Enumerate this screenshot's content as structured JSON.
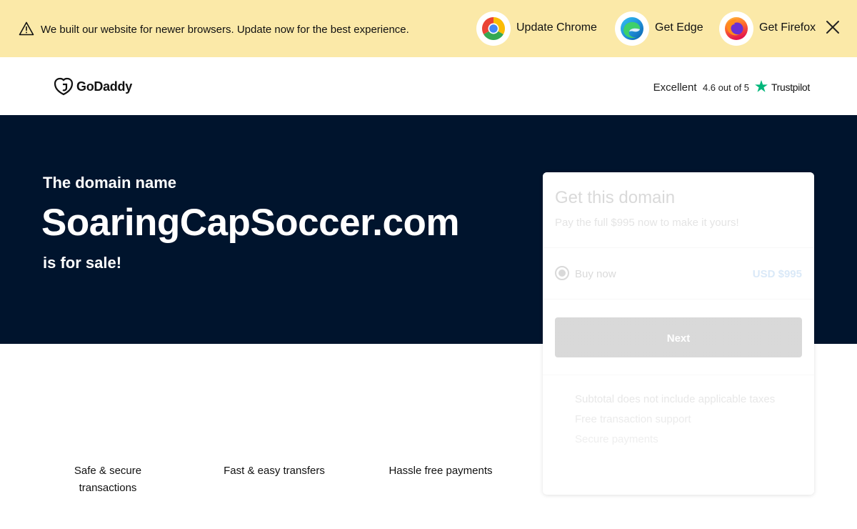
{
  "banner": {
    "message": "We built our website for newer browsers. Update now for the best experience.",
    "browsers": [
      {
        "name": "Update Chrome",
        "icon": "chrome-icon"
      },
      {
        "name": "Get Edge",
        "icon": "edge-icon"
      },
      {
        "name": "Get Firefox",
        "icon": "firefox-icon"
      }
    ],
    "background_color": "#fbe9a8"
  },
  "header": {
    "logo_text": "GoDaddy",
    "rating": {
      "label": "Excellent",
      "score_text": "4.6 out of 5",
      "provider": "Trustpilot",
      "star_color": "#00b67a"
    }
  },
  "hero": {
    "pre_text": "The domain name",
    "domain": "SoaringCapSoccer.com",
    "post_text": "is for sale!",
    "background_color": "#00142d"
  },
  "card": {
    "title": "Get this domain",
    "subtitle": "Pay the full $995 now to make it yours!",
    "option_label": "Buy now",
    "option_price": "USD $995",
    "button_label": "Next",
    "bullets": [
      "Subtotal does not include applicable taxes",
      "Free transaction support",
      "Secure payments"
    ],
    "price_color": "#1976d2"
  },
  "features": [
    "Safe & secure transactions",
    "Fast & easy transfers",
    "Hassle free payments"
  ]
}
